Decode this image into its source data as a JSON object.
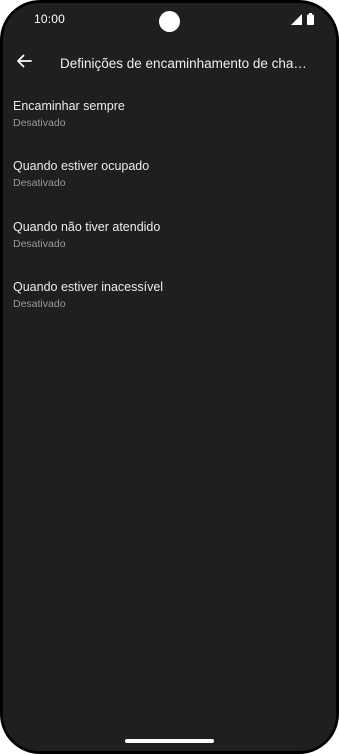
{
  "status_bar": {
    "time": "10:00"
  },
  "app_bar": {
    "title": "Definições de encaminhamento de chamadas"
  },
  "settings": [
    {
      "title": "Encaminhar sempre",
      "summary": "Desativado"
    },
    {
      "title": "Quando estiver ocupado",
      "summary": "Desativado"
    },
    {
      "title": "Quando não tiver atendido",
      "summary": "Desativado"
    },
    {
      "title": "Quando estiver inacessível",
      "summary": "Desativado"
    }
  ],
  "colors": {
    "background": "#1f1f1f",
    "text_primary": "#ececec",
    "text_secondary": "#9a9a9a"
  },
  "icons": {
    "back": "arrow-left-icon",
    "signal": "cell-signal-icon",
    "battery": "battery-icon"
  }
}
